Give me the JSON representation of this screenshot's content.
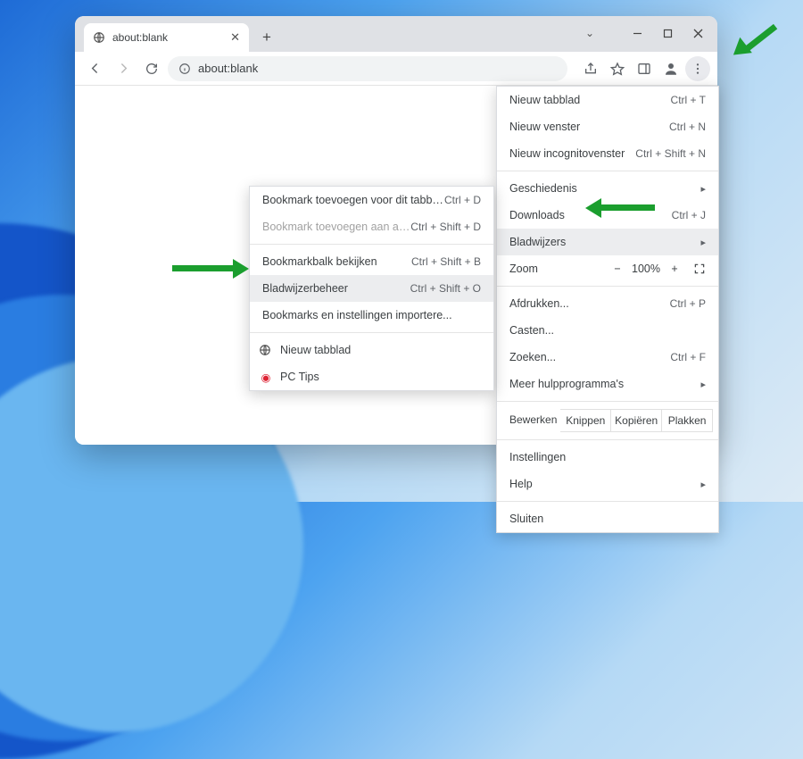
{
  "tab": {
    "title": "about:blank"
  },
  "address_bar": {
    "url": "about:blank"
  },
  "main_menu": {
    "items": [
      {
        "label": "Nieuw tabblad",
        "shortcut": "Ctrl + T"
      },
      {
        "label": "Nieuw venster",
        "shortcut": "Ctrl + N"
      },
      {
        "label": "Nieuw incognitovenster",
        "shortcut": "Ctrl + Shift + N"
      }
    ],
    "history": {
      "label": "Geschiedenis"
    },
    "downloads": {
      "label": "Downloads",
      "shortcut": "Ctrl + J"
    },
    "bookmarks": {
      "label": "Bladwijzers"
    },
    "zoom": {
      "label": "Zoom",
      "value": "100%",
      "minus": "−",
      "plus": "+"
    },
    "print": {
      "label": "Afdrukken...",
      "shortcut": "Ctrl + P"
    },
    "cast": {
      "label": "Casten..."
    },
    "find": {
      "label": "Zoeken...",
      "shortcut": "Ctrl + F"
    },
    "moretools": {
      "label": "Meer hulpprogramma's"
    },
    "edit": {
      "label": "Bewerken",
      "cut": "Knippen",
      "copy": "Kopiëren",
      "paste": "Plakken"
    },
    "settings": {
      "label": "Instellingen"
    },
    "help": {
      "label": "Help"
    },
    "exit": {
      "label": "Sluiten"
    }
  },
  "bookmarks_submenu": {
    "items": [
      {
        "label": "Bookmark toevoegen voor dit tabbla...",
        "shortcut": "Ctrl + D"
      },
      {
        "label": "Bookmark toevoegen aan alle tabbla...",
        "shortcut": "Ctrl + Shift + D",
        "disabled": true
      },
      {
        "label": "Bookmarkbalk bekijken",
        "shortcut": "Ctrl + Shift + B"
      },
      {
        "label": "Bladwijzerbeheer",
        "shortcut": "Ctrl + Shift + O",
        "highlight": true
      },
      {
        "label": "Bookmarks en instellingen importere..."
      },
      {
        "label": "Nieuw tabblad",
        "icon": "globe"
      },
      {
        "label": "PC Tips",
        "icon": "pctips"
      }
    ]
  }
}
